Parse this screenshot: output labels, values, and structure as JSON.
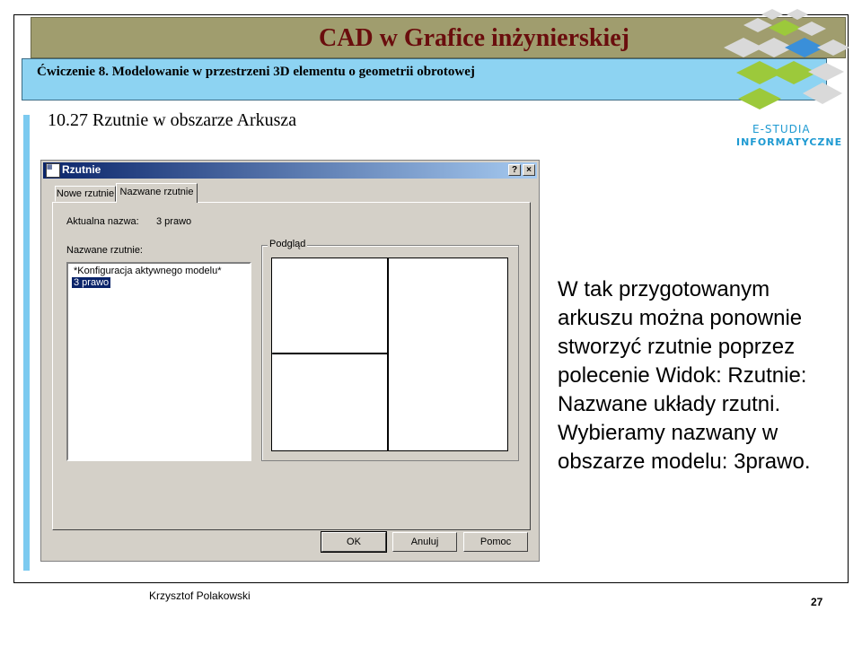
{
  "slide": {
    "title": "CAD w Grafice inżynierskiej",
    "subtitle": "Ćwiczenie 8. Modelowanie w przestrzeni 3D elementu o geometrii obrotowej",
    "section_heading": "10.27 Rzutnie w obszarze Arkusza",
    "logo": {
      "line1": "E-STUDIA",
      "line2": "INFORMATYCZNE",
      "colors": [
        "#9cc93b",
        "#3a8fd9",
        "#d9d9d9"
      ]
    },
    "body_text": "W tak przygotowanym arkuszu można ponownie stworzyć rzutnie poprzez polecenie Widok: Rzutnie: Nazwane układy rzutni. Wybieramy nazwany w obszarze modelu: 3prawo.",
    "footer_author": "Krzysztof Polakowski",
    "page_number": "27"
  },
  "dialog": {
    "title": "Rzutnie",
    "help_button": "?",
    "close_button": "×",
    "tabs": [
      {
        "label": "Nowe rzutnie"
      },
      {
        "label": "Nazwane rzutnie"
      }
    ],
    "current_name_label": "Aktualna nazwa:",
    "current_name_value": "3 prawo",
    "named_viewports_label": "Nazwane rzutnie:",
    "named_viewports": [
      {
        "label": "*Konfiguracja aktywnego modelu*",
        "selected": false
      },
      {
        "label": "3 prawo",
        "selected": true
      }
    ],
    "preview_label": "Podgląd",
    "buttons": {
      "ok": "OK",
      "cancel": "Anuluj",
      "help": "Pomoc"
    }
  }
}
